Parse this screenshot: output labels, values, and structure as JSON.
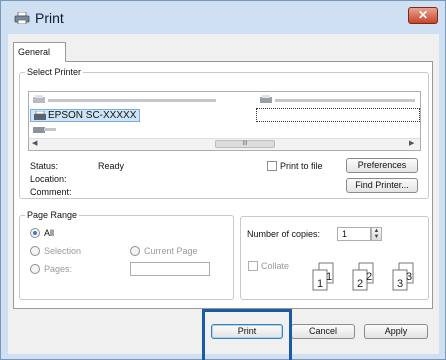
{
  "window": {
    "title": "Print",
    "close_label": "✕",
    "icon": "printer-icon"
  },
  "tabs": [
    {
      "label": "General"
    }
  ],
  "select_printer": {
    "legend": "Select Printer",
    "selected_printer": "EPSON SC-XXXXX",
    "printer_icon": "printer-icon",
    "scroll_thumb": "III",
    "status_label": "Status:",
    "status_value": "Ready",
    "location_label": "Location:",
    "comment_label": "Comment:",
    "print_to_file": "Print to file",
    "preferences": "Preferences",
    "find_printer": "Find Printer..."
  },
  "page_range": {
    "legend": "Page Range",
    "all": "All",
    "selection": "Selection",
    "current_page": "Current Page",
    "pages": "Pages:",
    "selected": "All"
  },
  "copies": {
    "label": "Number of copies:",
    "value": "1",
    "collate": "Collate",
    "collate_pages": [
      {
        "a": "1",
        "b": "1"
      },
      {
        "a": "2",
        "b": "2"
      },
      {
        "a": "3",
        "b": "3"
      }
    ]
  },
  "buttons": {
    "print": "Print",
    "cancel": "Cancel",
    "apply": "Apply"
  },
  "colors": {
    "accent": "#1b5aa6",
    "window_frame": "#cfe0f3",
    "close_button": "#c8432a"
  }
}
